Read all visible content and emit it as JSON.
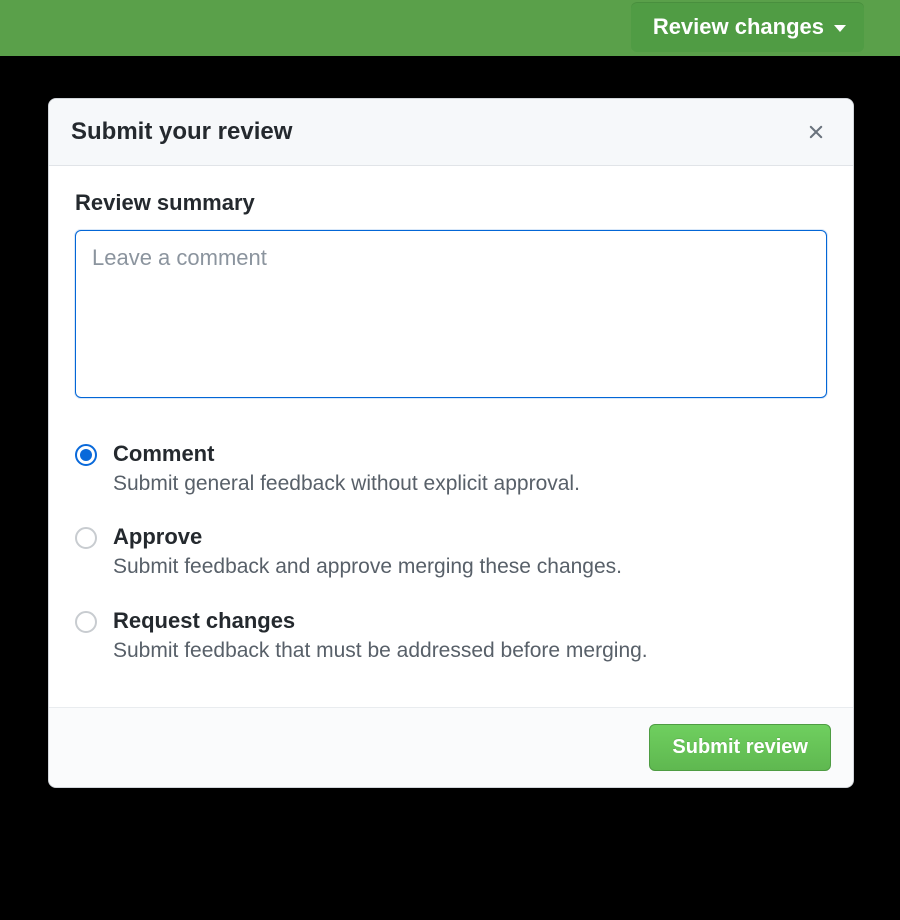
{
  "topbar": {
    "review_changes_label": "Review changes"
  },
  "panel": {
    "title": "Submit your review",
    "section_label": "Review summary",
    "comment_placeholder": "Leave a comment",
    "comment_value": "",
    "options": [
      {
        "title": "Comment",
        "desc": "Submit general feedback without explicit approval.",
        "selected": true
      },
      {
        "title": "Approve",
        "desc": "Submit feedback and approve merging these changes.",
        "selected": false
      },
      {
        "title": "Request changes",
        "desc": "Submit feedback that must be addressed before merging.",
        "selected": false
      }
    ],
    "submit_label": "Submit review"
  }
}
